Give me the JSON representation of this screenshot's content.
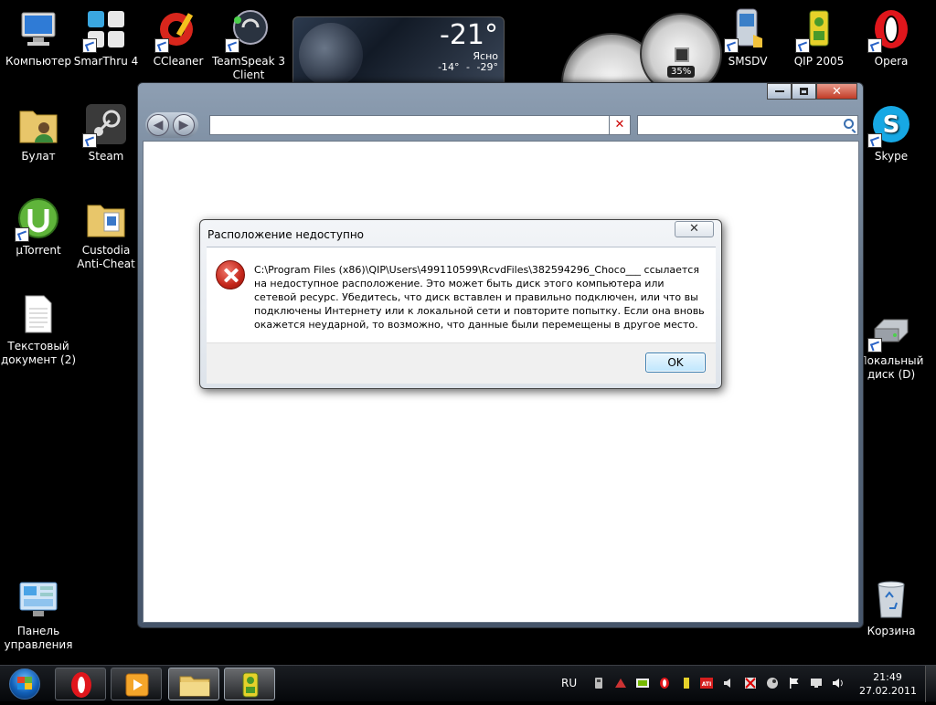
{
  "desktop_icons_left": [
    {
      "label": "Компьютер",
      "icon": "computer-icon"
    },
    {
      "label": "SmarThru 4",
      "icon": "smarthru-icon"
    },
    {
      "label": "CCleaner",
      "icon": "ccleaner-icon"
    },
    {
      "label": "TeamSpeak 3 Client",
      "icon": "teamspeak-icon"
    },
    {
      "label": "Булат",
      "icon": "user-folder-icon"
    },
    {
      "label": "Steam",
      "icon": "steam-icon"
    },
    {
      "label": "µTorrent",
      "icon": "utorrent-icon"
    },
    {
      "label": "Custodia Anti-Cheat",
      "icon": "folder-icon"
    },
    {
      "label": "Текстовый документ (2)",
      "icon": "text-document-icon"
    },
    {
      "label": "Панель управления",
      "icon": "control-panel-icon"
    }
  ],
  "desktop_icons_right": [
    {
      "label": "SMSDV",
      "icon": "smsdv-icon"
    },
    {
      "label": "QIP 2005",
      "icon": "qip-icon"
    },
    {
      "label": "Opera",
      "icon": "opera-icon"
    },
    {
      "label": "Skype",
      "icon": "skype-icon"
    },
    {
      "label": "Локальный диск (D)",
      "icon": "local-disk-icon"
    },
    {
      "label": "Корзина",
      "icon": "recycle-bin-icon"
    }
  ],
  "weather": {
    "temp": "-21°",
    "condition": "Ясно",
    "low": "-14°",
    "sep": "-",
    "high": "-29°"
  },
  "cpu_gadget": {
    "percent": "35%"
  },
  "explorer": {
    "address": "",
    "search_placeholder": ""
  },
  "dialog": {
    "title": "Расположение недоступно",
    "close_glyph": "✕",
    "message": "C:\\Program Files (x86)\\QIP\\Users\\499110599\\RcvdFiles\\382594296_Choco___ ссылается на недоступное расположение. Это может быть диск этого компьютера или сетевой ресурс. Убедитесь, что диск вставлен и правильно подключен, или что вы подключены Интернету или к локальной сети и повторите попытку. Если она вновь окажется неударной, то возможно, что данные были перемещены в другое место.",
    "ok_label": "OK"
  },
  "taskbar": {
    "pinned": [
      "opera-icon",
      "media-player-icon",
      "explorer-folder-icon",
      "qip-icon"
    ],
    "language": "RU",
    "time": "21:49",
    "date": "27.02.2011"
  },
  "colors": {
    "error_red": "#c4261a",
    "ok_button_border": "#3c7fb1",
    "taskbar": "#0b0d10"
  }
}
